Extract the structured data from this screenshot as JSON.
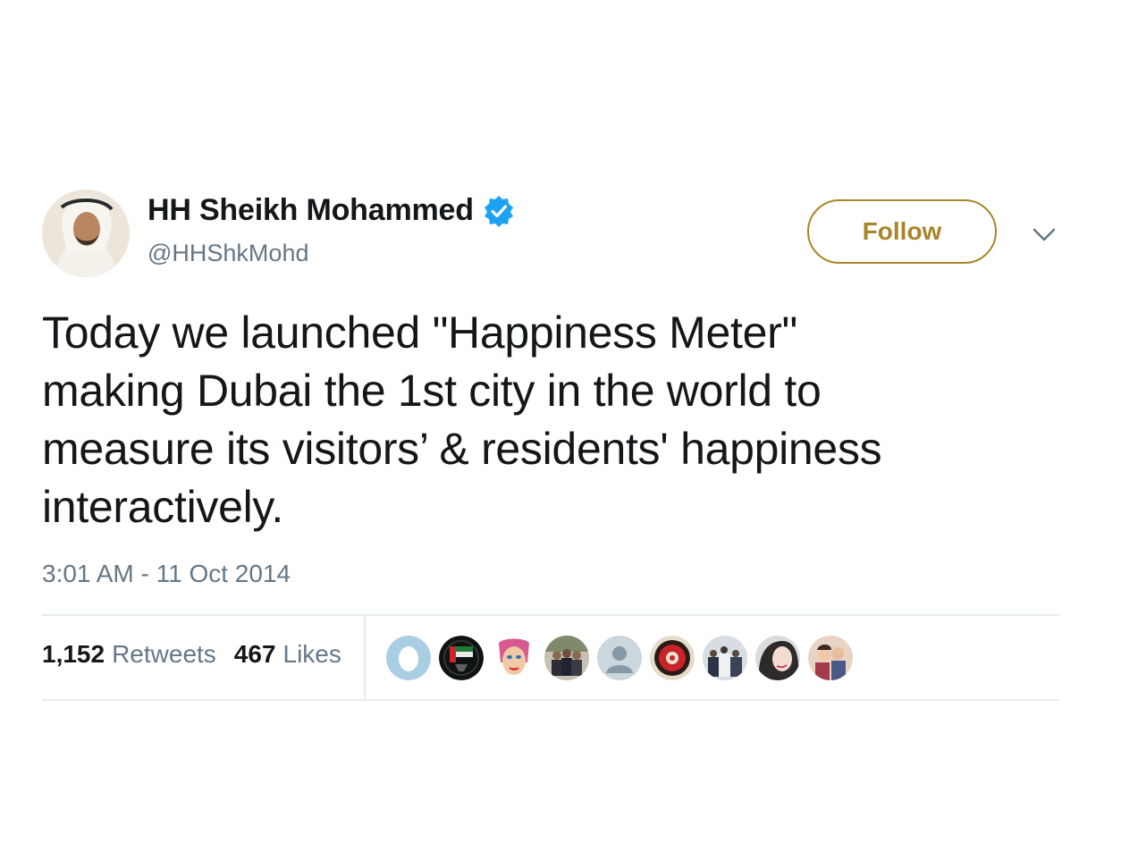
{
  "author": {
    "display_name": "HH Sheikh Mohammed",
    "handle": "@HHShkMohd",
    "verified": true
  },
  "follow_button": {
    "label": "Follow"
  },
  "tweet": {
    "lines": [
      "Today we launched \"Happiness Meter\"",
      "making Dubai the 1st city in the world to",
      "measure its visitors’ & residents' happiness",
      "interactively."
    ],
    "timestamp": "3:01 AM - 11 Oct 2014"
  },
  "stats": {
    "retweets_count": "1,152",
    "retweets_label": "Retweets",
    "likes_count": "467",
    "likes_label": "Likes"
  },
  "liker_avatars": [
    "egg-avatar",
    "emblem-avatar",
    "pop-art-avatar",
    "group-photo-avatar",
    "default-user-avatar",
    "red-seal-avatar",
    "crowd-photo-avatar",
    "portrait-avatar",
    "family-photo-avatar"
  ],
  "colors": {
    "accent_gold": "#a8852a",
    "verified_blue": "#1da1f2",
    "secondary_text": "#657786",
    "primary_text": "#14171a",
    "divider": "#e6ecf0"
  }
}
